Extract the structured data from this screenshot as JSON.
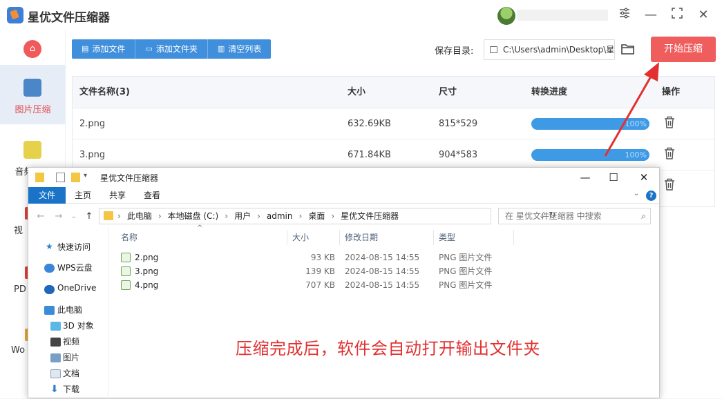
{
  "app": {
    "title": "星优文件压缩器"
  },
  "window_controls": {
    "settings": "≡",
    "minimize": "—",
    "maximize": "⛶",
    "close": "✕"
  },
  "sidebar": {
    "home_icon": "home-icon",
    "items": [
      {
        "label": "图片压缩",
        "active": true
      },
      {
        "label": "音频压缩",
        "active": false
      }
    ],
    "fragments": [
      "视",
      "PD",
      "Wo"
    ]
  },
  "toolbar": {
    "add_file": "添加文件",
    "add_folder": "添加文件夹",
    "clear_list": "清空列表",
    "save_label": "保存目录:",
    "save_path": "C:\\Users\\admin\\Desktop\\星",
    "start": "开始压缩"
  },
  "table": {
    "headers": [
      "文件名称(3)",
      "大小",
      "尺寸",
      "转换进度",
      "操作"
    ],
    "rows": [
      {
        "name": "2.png",
        "size": "632.69KB",
        "dims": "815*529",
        "progress": "100%",
        "progress_value": 100
      },
      {
        "name": "3.png",
        "size": "671.84KB",
        "dims": "904*583",
        "progress": "100%",
        "progress_value": 100
      }
    ]
  },
  "explorer": {
    "title": "星优文件压缩器",
    "ribbon_tabs": [
      "文件",
      "主页",
      "共享",
      "查看"
    ],
    "help": "?",
    "breadcrumbs": [
      "此电脑",
      "本地磁盘 (C:)",
      "用户",
      "admin",
      "桌面",
      "星优文件压缩器"
    ],
    "search_placeholder": "在 星优文件压缩器 中搜索",
    "nav_items": [
      "快速访问",
      "WPS云盘",
      "OneDrive",
      "此电脑",
      "3D 对象",
      "视频",
      "图片",
      "文档",
      "下载"
    ],
    "columns": [
      "名称",
      "大小",
      "修改日期",
      "类型"
    ],
    "files": [
      {
        "name": "2.png",
        "size": "93 KB",
        "date": "2024-08-15 14:55",
        "type": "PNG 图片文件"
      },
      {
        "name": "3.png",
        "size": "139 KB",
        "date": "2024-08-15 14:55",
        "type": "PNG 图片文件"
      },
      {
        "name": "4.png",
        "size": "707 KB",
        "date": "2024-08-15 14:55",
        "type": "PNG 图片文件"
      }
    ]
  },
  "annotation": {
    "text": "压缩完成后，软件会自动打开输出文件夹",
    "color": "#e23030"
  },
  "colors": {
    "accent_blue": "#3f8fdc",
    "accent_red": "#f05d5d",
    "progress": "#3f9ae6"
  }
}
